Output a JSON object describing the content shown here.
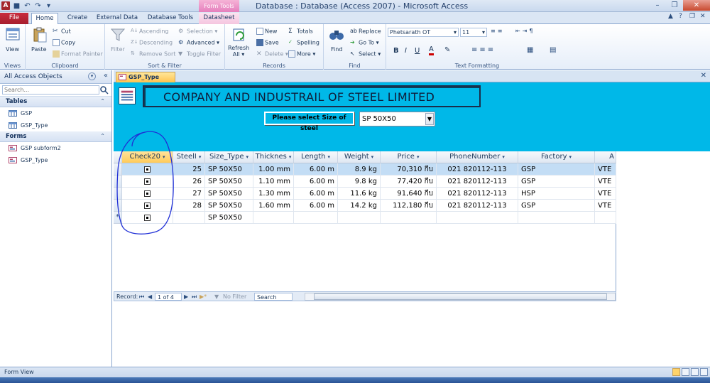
{
  "window": {
    "title": "Database : Database (Access 2007)  -  Microsoft Access",
    "context_tab_group": "Form Tools"
  },
  "ribbon_tabs": [
    "File",
    "Home",
    "Create",
    "External Data",
    "Database Tools",
    "Datasheet"
  ],
  "ribbon": {
    "views": {
      "view_label": "View",
      "group": "Views"
    },
    "clipboard": {
      "paste": "Paste",
      "cut": "Cut",
      "copy": "Copy",
      "format_painter": "Format Painter",
      "group": "Clipboard"
    },
    "sort_filter": {
      "filter": "Filter",
      "ascending": "Ascending",
      "descending": "Descending",
      "remove_sort": "Remove Sort",
      "selection": "Selection",
      "advanced": "Advanced",
      "toggle_filter": "Toggle Filter",
      "group": "Sort & Filter"
    },
    "records": {
      "refresh_all_1": "Refresh",
      "refresh_all_2": "All",
      "new": "New",
      "save": "Save",
      "delete": "Delete",
      "totals": "Totals",
      "spelling": "Spelling",
      "more": "More",
      "group": "Records"
    },
    "find": {
      "find": "Find",
      "replace": "Replace",
      "goto": "Go To",
      "select": "Select",
      "group": "Find"
    },
    "text_formatting": {
      "font": "Phetsarath OT",
      "size": "11",
      "bold": "B",
      "italic": "I",
      "underline": "U",
      "group": "Text Formatting"
    }
  },
  "nav_pane": {
    "title": "All Access Objects",
    "search_placeholder": "Search...",
    "sections": [
      {
        "name": "Tables",
        "items": [
          "GSP",
          "GSP_Type"
        ]
      },
      {
        "name": "Forms",
        "items": [
          "GSP subform2",
          "GSP_Type"
        ]
      }
    ]
  },
  "document_tab": "GSP_Type",
  "form": {
    "title": "COMPANY AND INDUSTRAIL OF STEEL LIMITED",
    "select_label": "Please select  Size of steel",
    "size_value": "SP 50X50"
  },
  "datasheet": {
    "columns": [
      "Check20",
      "SteelI",
      "Size_Type",
      "Thicknes",
      "Length",
      "Weight",
      "Price",
      "PhoneNumber",
      "Factory",
      "A"
    ],
    "rows": [
      {
        "id": "25",
        "size": "SP 50X50",
        "thick": "1.00 mm",
        "len": "6.00 m",
        "weight": "8.9 kg",
        "price": "70,310 กีบ",
        "phone": "021 820112-113",
        "factory": "GSP",
        "a": "VTE"
      },
      {
        "id": "26",
        "size": "SP 50X50",
        "thick": "1.10 mm",
        "len": "6.00 m",
        "weight": "9.8 kg",
        "price": "77,420 กีบ",
        "phone": "021 820112-113",
        "factory": "GSP",
        "a": "VTE"
      },
      {
        "id": "27",
        "size": "SP 50X50",
        "thick": "1.30 mm",
        "len": "6.00 m",
        "weight": "11.6 kg",
        "price": "91,640 กีบ",
        "phone": "021 820112-113",
        "factory": "HSP",
        "a": "VTE"
      },
      {
        "id": "28",
        "size": "SP 50X50",
        "thick": "1.60 mm",
        "len": "6.00 m",
        "weight": "14.2 kg",
        "price": "112,180 กีบ",
        "phone": "021 820112-113",
        "factory": "GSP",
        "a": "VTE"
      }
    ],
    "new_row_size": "SP 50X50"
  },
  "record_nav": {
    "label": "Record:",
    "position": "1 of 4",
    "filter": "No Filter",
    "search": "Search"
  },
  "status": {
    "text": "Form View"
  },
  "colors": {
    "form_header_bg": "#00b8e8",
    "selected_row": "#c3ddf5",
    "annotation_circle": "#1f2fd6",
    "file_tab": "#c92c3e"
  }
}
